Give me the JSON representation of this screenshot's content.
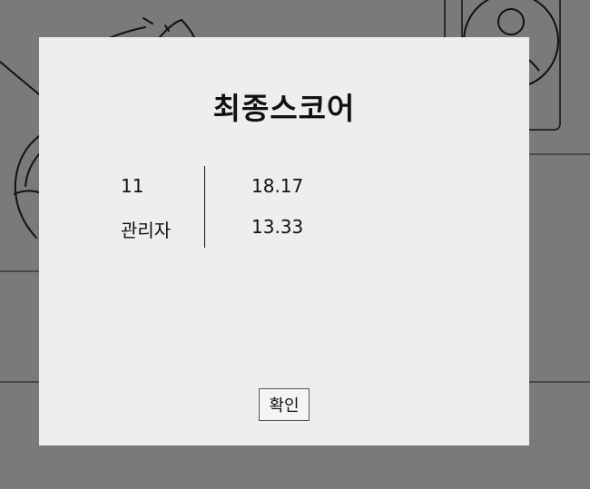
{
  "modal": {
    "title": "최종스코어",
    "scores": [
      {
        "name": "11",
        "score": "18.17"
      },
      {
        "name": "관리자",
        "score": "13.33"
      }
    ],
    "confirm_label": "확인"
  },
  "background": {
    "avatar_icon": "user-avatar-icon"
  },
  "colors": {
    "overlay": "#7a7a79",
    "modal_bg": "#eeeeee",
    "text": "#111111"
  }
}
